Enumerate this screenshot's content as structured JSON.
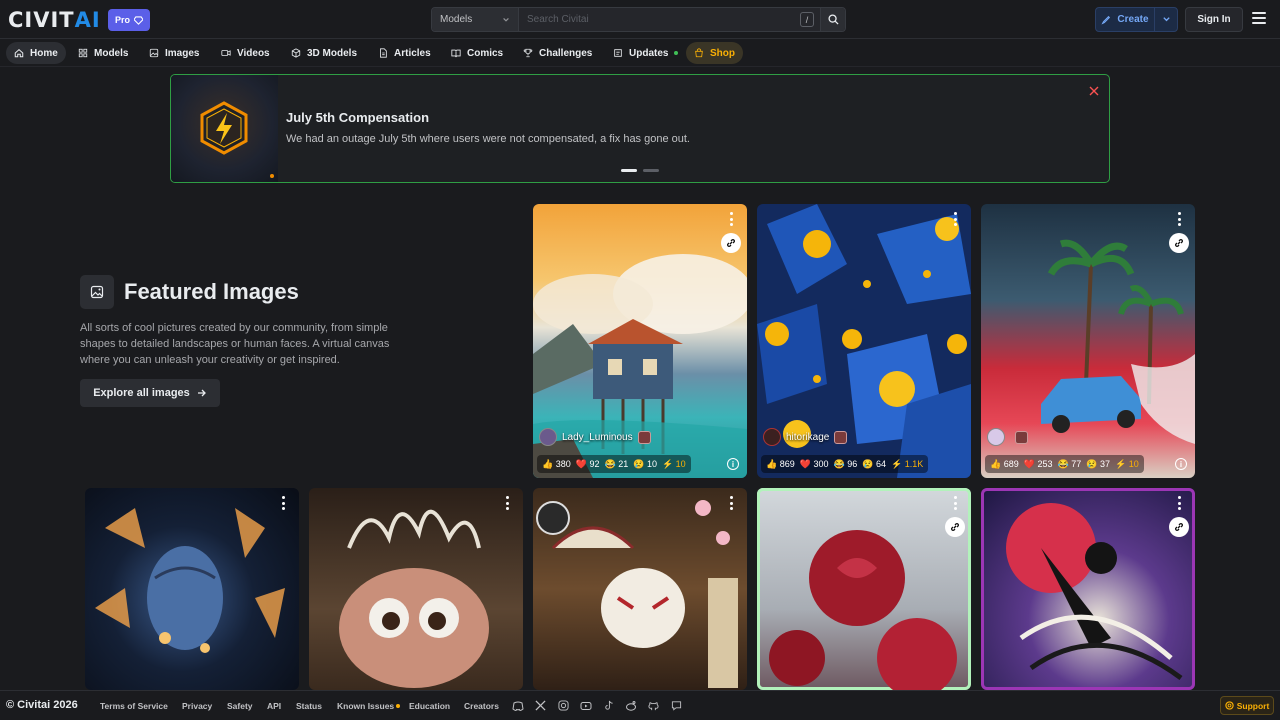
{
  "header": {
    "logo_main": "CIVIT",
    "logo_accent": "AI",
    "pro_label": "Pro",
    "search_category": "Models",
    "search_placeholder": "Search Civitai",
    "search_shortcut": "/",
    "create_label": "Create",
    "signin_label": "Sign In"
  },
  "nav": {
    "tabs": [
      {
        "label": "Home",
        "icon": "home-icon",
        "active": true
      },
      {
        "label": "Models",
        "icon": "grid-icon"
      },
      {
        "label": "Images",
        "icon": "image-icon"
      },
      {
        "label": "Videos",
        "icon": "video-icon"
      },
      {
        "label": "3D Models",
        "icon": "cube-icon"
      },
      {
        "label": "Articles",
        "icon": "article-icon"
      },
      {
        "label": "Comics",
        "icon": "book-icon"
      },
      {
        "label": "Challenges",
        "icon": "trophy-icon"
      },
      {
        "label": "Updates",
        "icon": "updates-icon"
      },
      {
        "label": "Shop",
        "icon": "shop-icon"
      }
    ]
  },
  "announcement": {
    "title": "July 5th Compensation",
    "text": "We had an outage July 5th where users were not compensated, a fix has gone out."
  },
  "featured": {
    "title": "Featured Images",
    "description": "All sorts of cool pictures created by our community, from simple shapes to detailed landscapes or human faces. A virtual canvas where you can unleash your creativity or get inspired.",
    "button_label": "Explore all images"
  },
  "cards": [
    {
      "username": "Lady_Luminous",
      "likes": "380",
      "hearts": "92",
      "laughs": "21",
      "cries": "10",
      "buzz": "10"
    },
    {
      "username": "hitorikage",
      "likes": "869",
      "hearts": "300",
      "laughs": "96",
      "cries": "64",
      "buzz": "1.1K"
    },
    {
      "username": "",
      "likes": "689",
      "hearts": "253",
      "laughs": "77",
      "cries": "37",
      "buzz": "10"
    }
  ],
  "footer": {
    "copyright": "© Civitai 2026",
    "links": [
      "Terms of Service",
      "Privacy",
      "Safety",
      "API",
      "Status",
      "Known Issues",
      "Education",
      "Creators"
    ],
    "support_label": "Support"
  },
  "colors": {
    "accent": "#228be6",
    "pro": "#5b5fe8",
    "announce_border": "#2f9e44",
    "buzz": "#fab005"
  }
}
